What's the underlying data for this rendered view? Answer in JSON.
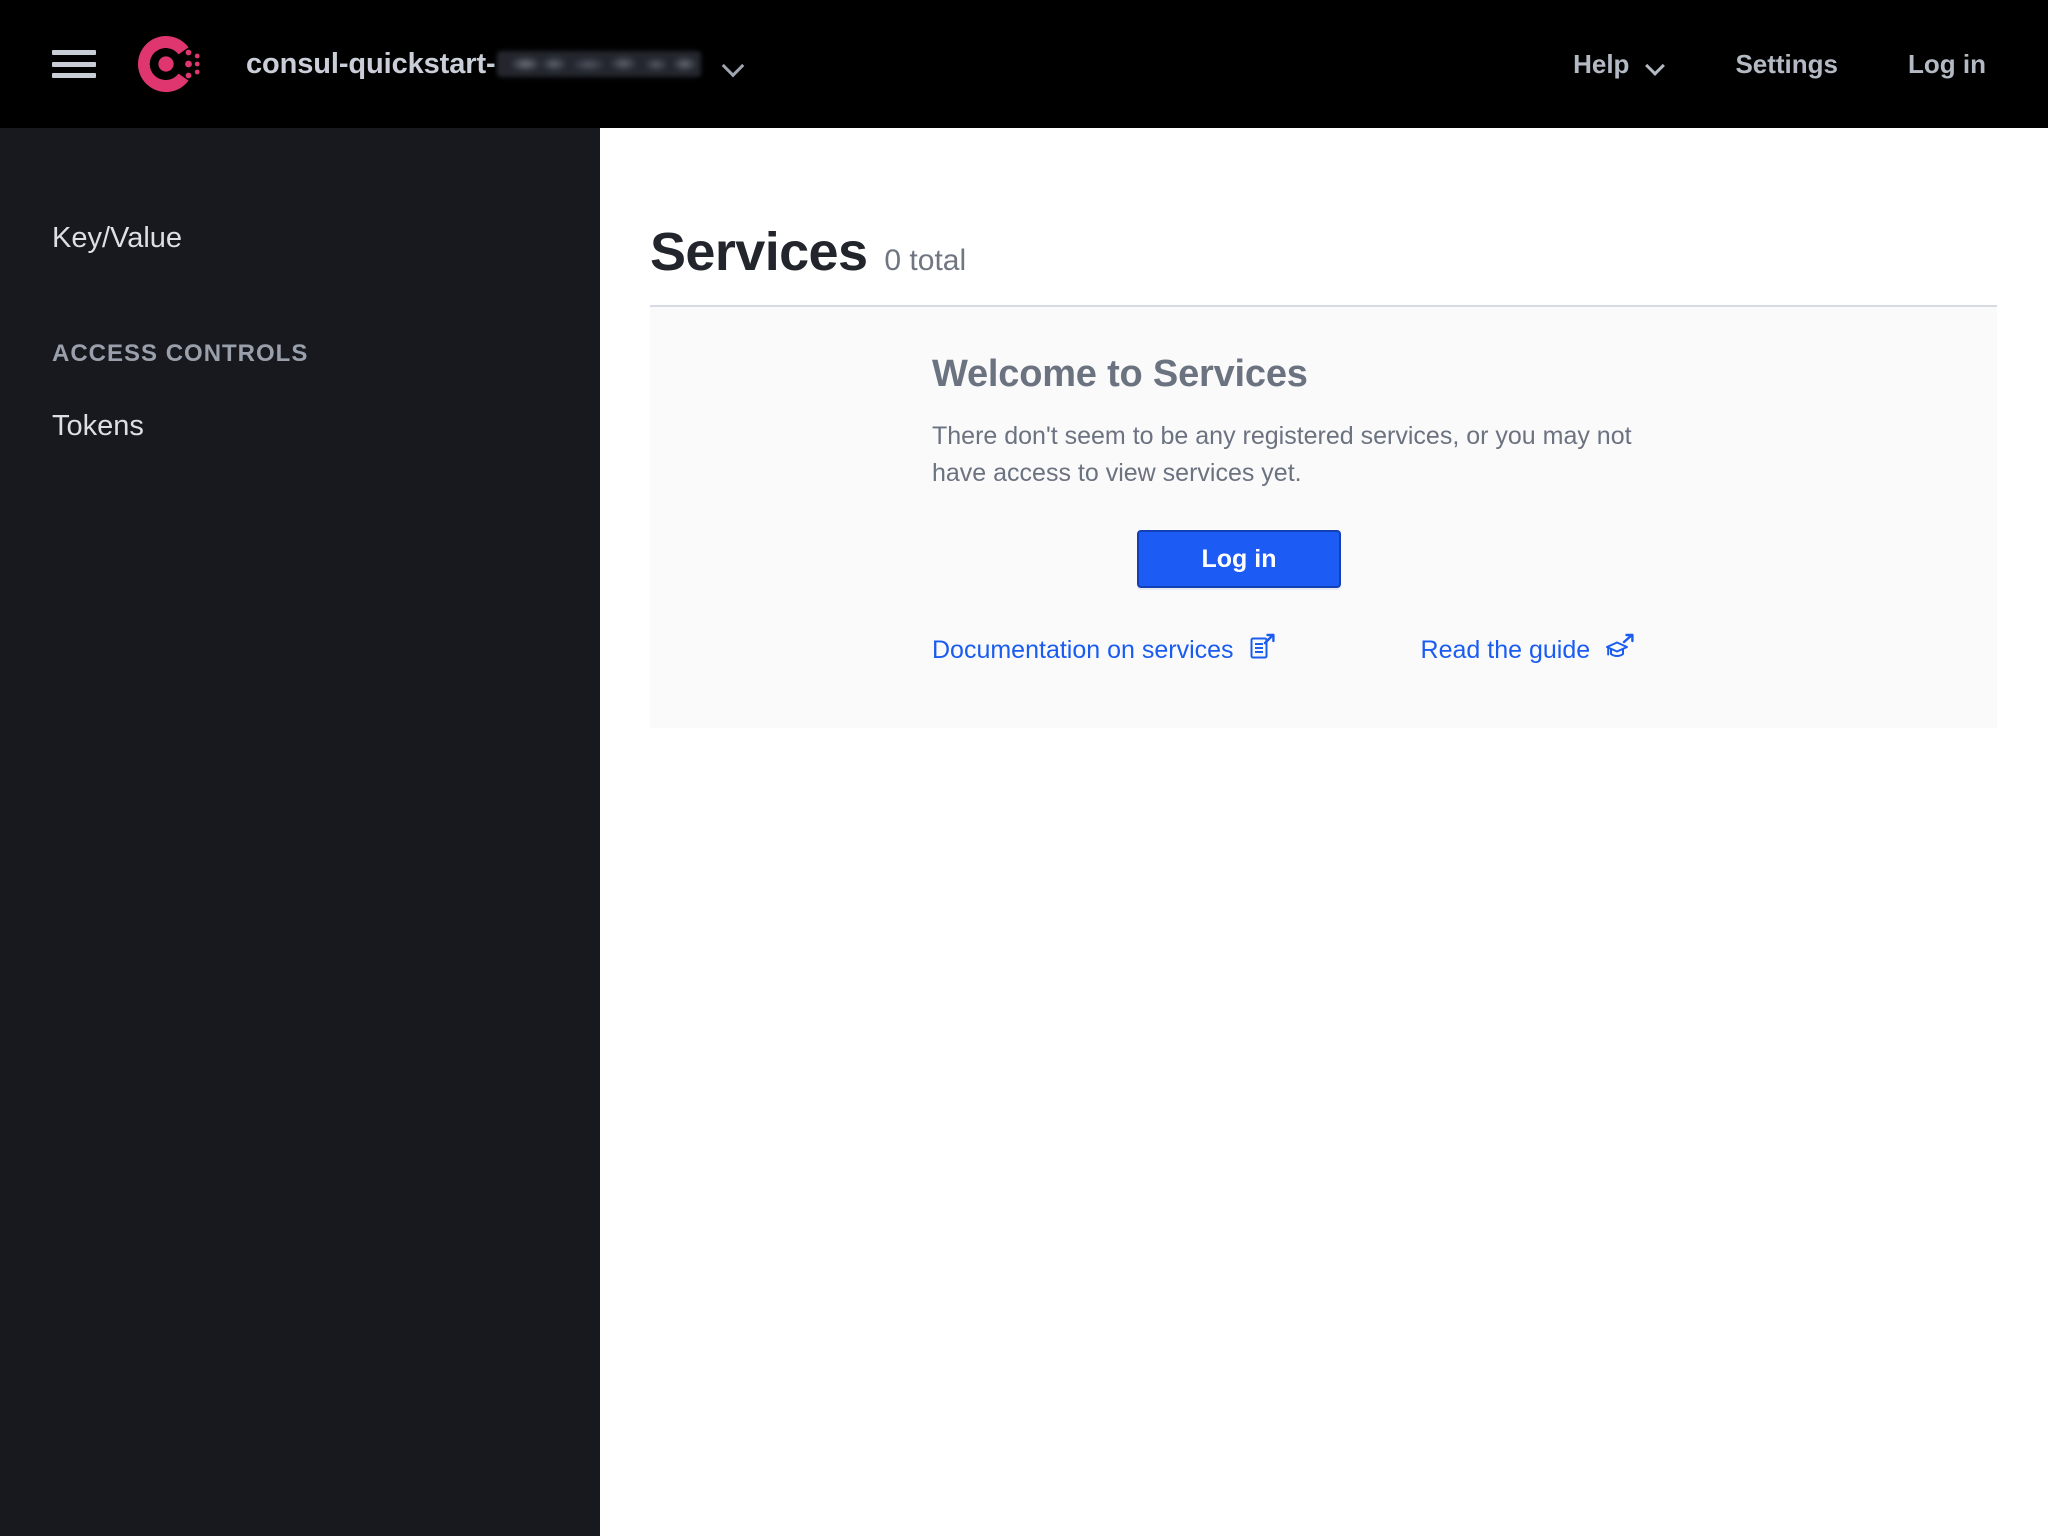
{
  "header": {
    "menu_icon": "hamburger-menu-icon",
    "logo": "consul-logo",
    "datacenter_name": "consul-quickstart-",
    "datacenter_suffix_redacted": true,
    "datacenter_chevron": "chevron-down-icon",
    "nav": {
      "help_label": "Help",
      "help_chevron": "chevron-down-icon",
      "settings_label": "Settings",
      "login_label": "Log in"
    }
  },
  "sidebar": {
    "items": [
      {
        "label": "Key/Value",
        "type": "link"
      }
    ],
    "section_heading": "ACCESS CONTROLS",
    "section_items": [
      {
        "label": "Tokens",
        "type": "link"
      }
    ]
  },
  "main": {
    "page_title": "Services",
    "page_count": "0 total",
    "panel": {
      "title": "Welcome to Services",
      "body": "There don't seem to be any registered services, or you may not have access to view services yet.",
      "login_button": "Log in",
      "links": [
        {
          "label": "Documentation on services",
          "icon": "document-external-link-icon"
        },
        {
          "label": "Read the guide",
          "icon": "graduation-cap-external-link-icon"
        }
      ]
    }
  },
  "colors": {
    "header_bg": "#000000",
    "sidebar_bg": "#17191e",
    "brand_pink": "#e0366f",
    "accent_blue": "#1c5cf5",
    "link_blue": "#1a5cf0",
    "panel_bg": "#fafafb",
    "panel_border": "#d8dbe3",
    "title_dark": "#22252b",
    "muted_text": "#6b7280"
  }
}
